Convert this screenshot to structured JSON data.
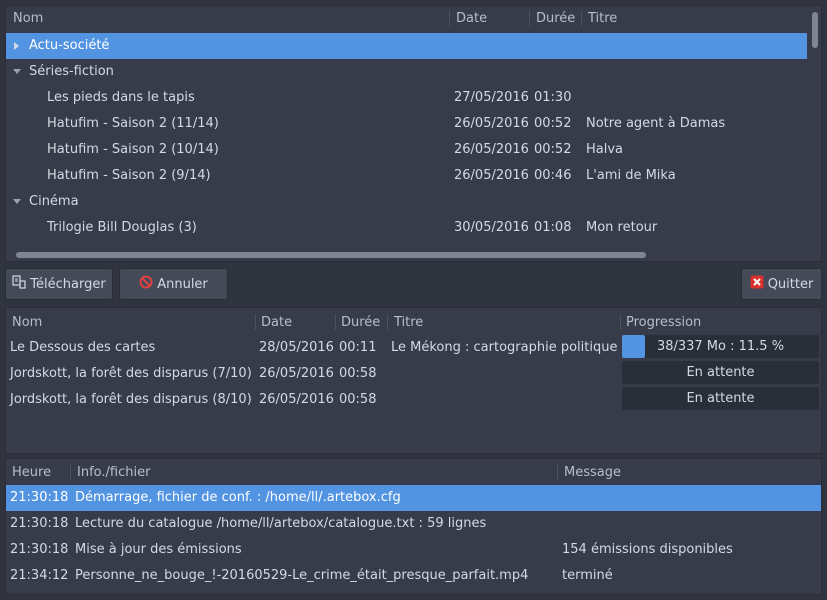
{
  "catalog": {
    "columns": {
      "name": "Nom",
      "date": "Date",
      "duration": "Durée",
      "title": "Titre"
    },
    "groups": [
      {
        "label": "Actu-société"
      },
      {
        "label": "Séries-fiction"
      },
      {
        "label": "Cinéma"
      }
    ],
    "items": [
      {
        "name": "Les pieds dans le tapis",
        "date": "27/05/2016",
        "duration": "01:30",
        "title": ""
      },
      {
        "name": "Hatufim - Saison 2 (11/14)",
        "date": "26/05/2016",
        "duration": "00:52",
        "title": "Notre agent à Damas"
      },
      {
        "name": "Hatufim -  Saison 2 (10/14)",
        "date": "26/05/2016",
        "duration": "00:52",
        "title": "Halva"
      },
      {
        "name": "Hatufim - Saison 2 (9/14)",
        "date": "26/05/2016",
        "duration": "00:46",
        "title": "L'ami de Mika"
      },
      {
        "name": "Trilogie Bill Douglas (3)",
        "date": "30/05/2016",
        "duration": "01:08",
        "title": "Mon retour"
      }
    ]
  },
  "toolbar": {
    "download_label": "Télécharger",
    "cancel_label": "Annuler",
    "quit_label": "Quitter"
  },
  "downloads": {
    "columns": {
      "name": "Nom",
      "date": "Date",
      "duration": "Durée",
      "title": "Titre",
      "progress": "Progression"
    },
    "rows": [
      {
        "name": "Le Dessous des cartes",
        "date": "28/05/2016",
        "duration": "00:11",
        "title": "Le Mékong : cartographie politique",
        "progress": "38/337 Mo : 11.5 %",
        "fraction": 0.115
      },
      {
        "name": "Jordskott, la forêt des disparus (7/10)",
        "date": "26/05/2016",
        "duration": "00:58",
        "title": "",
        "progress": "En attente",
        "fraction": 0
      },
      {
        "name": "Jordskott, la forêt des disparus (8/10)",
        "date": "26/05/2016",
        "duration": "00:58",
        "title": "",
        "progress": "En attente",
        "fraction": 0
      }
    ]
  },
  "log": {
    "columns": {
      "time": "Heure",
      "info": "Info./fichier",
      "message": "Message"
    },
    "rows": [
      {
        "time": "21:30:18",
        "info": "Démarrage, fichier de conf. : /home/ll/.artebox.cfg",
        "message": ""
      },
      {
        "time": "21:30:18",
        "info": "Lecture du catalogue /home/ll/artebox/catalogue.txt : 59 lignes",
        "message": ""
      },
      {
        "time": "21:30:18",
        "info": "Mise à jour des émissions",
        "message": "154 émissions disponibles"
      },
      {
        "time": "21:34:12",
        "info": "Personne_ne_bouge_!-20160529-Le_crime_était_presque_parfait.mp4",
        "message": "terminé"
      }
    ]
  },
  "colors": {
    "selection": "#5294e2",
    "background": "#383c4a",
    "window": "#2f343f"
  }
}
